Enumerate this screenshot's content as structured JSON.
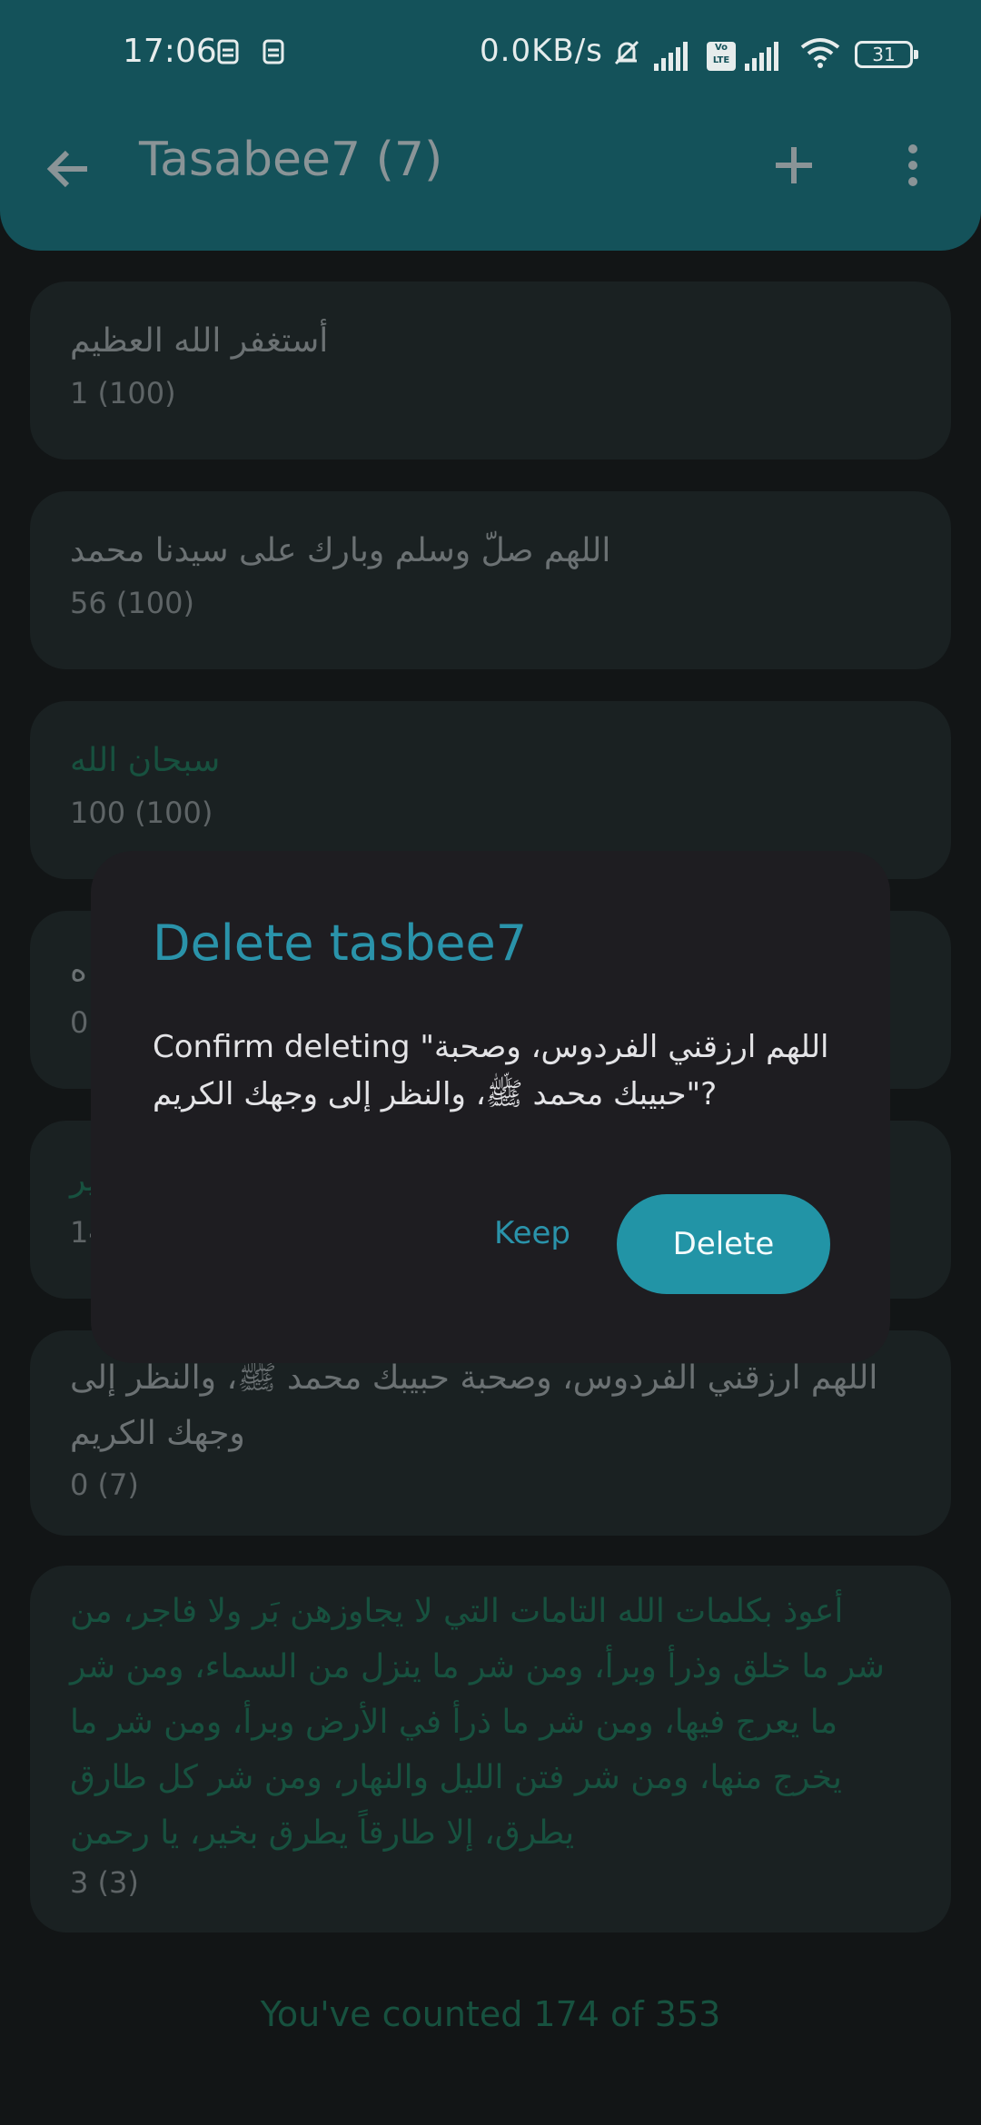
{
  "status_bar": {
    "time": "17:06",
    "network_speed": "0.0KB/s",
    "battery_level": "31",
    "volte_label": "Vo LTE",
    "left_icons": [
      "sim-alert-icon",
      "sim-alert-icon"
    ],
    "right_icons": [
      "silent-icon",
      "signal-icon",
      "volte-icon",
      "signal-icon",
      "wifi-icon",
      "battery-icon"
    ]
  },
  "appbar": {
    "title": "Tasabee7 (7)",
    "back_icon": "arrow-left-icon",
    "add_icon": "plus-icon",
    "more_icon": "more-vert-icon",
    "color": "#14525a"
  },
  "tasbeeh_list": [
    {
      "text": "أستغفر الله العظيم",
      "count": "1 (100)",
      "completed": false
    },
    {
      "text": "اللهم صلّ وسلم وبارك على سيدنا محمد",
      "count": "56 (100)",
      "completed": false
    },
    {
      "text": "سبحان الله",
      "count": "100 (100)",
      "completed": true
    },
    {
      "text": "ه",
      "count": "0",
      "completed": false
    },
    {
      "text": "ير",
      "count": "14",
      "completed": true
    },
    {
      "text": "اللهم ارزقني الفردوس، وصحبة حبيبك محمد ﷺ، والنظر إلى وجهك الكريم",
      "count": "0 (7)",
      "completed": false
    },
    {
      "text": "أعوذ بكلمات الله التامات التي لا يجاوزهن بَر ولا فاجر، من شر ما خلق وذرأ وبرأ، ومن شر ما ينزل من السماء، ومن شر ما يعرج فيها، ومن شر ما ذرأ في الأرض وبرأ، ومن شر ما يخرج منها، ومن شر فتن الليل والنهار، ومن شر كل طارق يطرق، إلا طارقاً يطرق بخير، يا رحمن",
      "count": "3 (3)",
      "completed": true
    }
  ],
  "footer": {
    "summary": "You've counted 174 of 353"
  },
  "dialog": {
    "title": "Delete tasbee7",
    "body": "Confirm deleting \"اللهم ارزقني الفردوس، وصحبة حبيبك محمد ﷺ، والنظر إلى وجهك الكريم\"?",
    "keep_label": "Keep",
    "delete_label": "Delete",
    "accent_color": "#2294a6"
  },
  "colors": {
    "background": "#121516",
    "card": "#1a2122",
    "completed_text": "#17513f",
    "dialog": "#1e1d21"
  }
}
